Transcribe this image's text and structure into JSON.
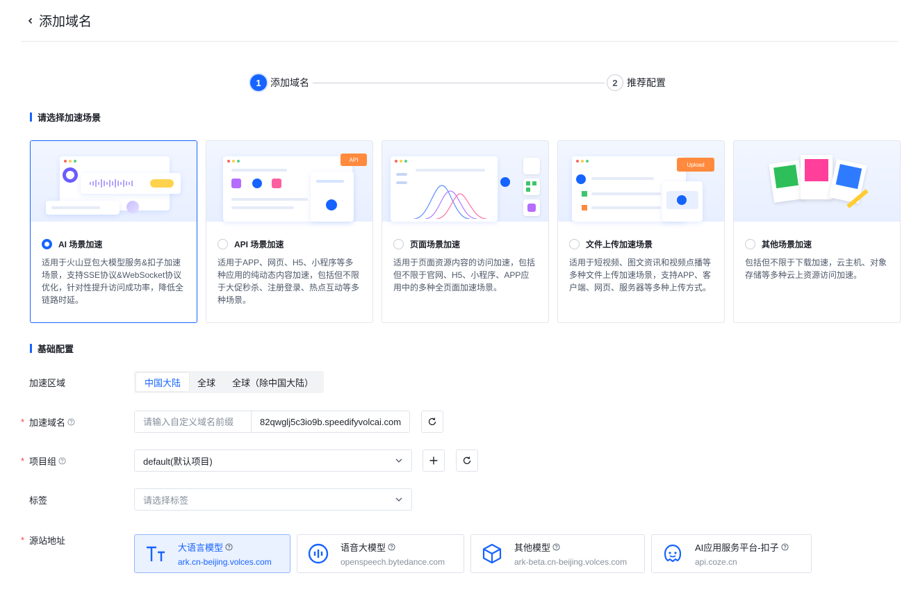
{
  "page": {
    "title": "添加域名"
  },
  "steps": [
    {
      "num": "1",
      "label": "添加域名",
      "active": true
    },
    {
      "num": "2",
      "label": "推荐配置",
      "active": false
    }
  ],
  "scenario_section": {
    "title": "请选择加速场景"
  },
  "scenarios": [
    {
      "title": "AI 场景加速",
      "desc": "适用于火山豆包大模型服务&扣子加速场景，支持SSE协议&WebSocket协议优化，针对性提升访问成功率，降低全链路时延。",
      "selected": true
    },
    {
      "title": "API 场景加速",
      "desc": "适用于APP、网页、H5、小程序等多种应用的纯动态内容加速，包括但不限于大促秒杀、注册登录、热点互动等多种场景。",
      "selected": false,
      "tag": "API"
    },
    {
      "title": "页面场景加速",
      "desc": "适用于页面资源内容的访问加速，包括但不限于官网、H5、小程序、APP应用中的多种全页面加速场景。",
      "selected": false
    },
    {
      "title": "文件上传加速场景",
      "desc": "适用于短视频、图文资讯和视频点播等多种文件上传加速场景，支持APP、客户端、网页、服务器等多种上传方式。",
      "selected": false,
      "tag": "Upload"
    },
    {
      "title": "其他场景加速",
      "desc": "包括但不限于下载加速，云主机、对象存储等多种云上资源访问加速。",
      "selected": false
    }
  ],
  "basic_section": {
    "title": "基础配置"
  },
  "form": {
    "region": {
      "label": "加速区域",
      "options": [
        "中国大陆",
        "全球",
        "全球（除中国大陆）"
      ],
      "selected": "中国大陆"
    },
    "domain": {
      "label": "加速域名",
      "required": "*",
      "placeholder": "请输入自定义域名前缀",
      "suffix": "82qwglj5c3io9b.speedifyvolcai.com"
    },
    "project": {
      "label": "项目组",
      "required": "*",
      "value": "default(默认项目)"
    },
    "tags": {
      "label": "标签",
      "placeholder": "请选择标签"
    },
    "origin": {
      "label": "源站地址",
      "required": "*",
      "options": [
        {
          "title": "大语言模型",
          "sub": "ark.cn-beijing.volces.com",
          "icon": "text-model-icon",
          "selected": true
        },
        {
          "title": "语音大模型",
          "sub": "openspeech.bytedance.com",
          "icon": "voice-model-icon",
          "selected": false
        },
        {
          "title": "其他模型",
          "sub": "ark-beta.cn-beijing.volces.com",
          "icon": "cube-icon",
          "selected": false
        },
        {
          "title": "AI应用服务平台-扣子",
          "sub": "api.coze.cn",
          "icon": "coze-icon",
          "selected": false
        }
      ]
    }
  },
  "colors": {
    "primary": "#1664ff",
    "border": "#dde2e9",
    "danger": "#f53f3f",
    "text": "#1d2129",
    "muted": "#86909c"
  }
}
